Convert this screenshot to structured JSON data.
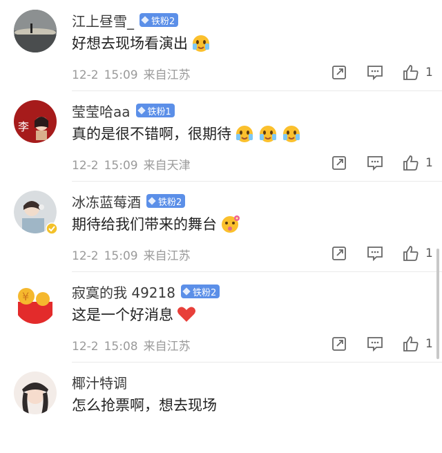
{
  "comments": [
    {
      "name": "江上昼雪_",
      "badge": "铁粉2",
      "text": "好想去现场看演出",
      "emojis": [
        "blush-face"
      ],
      "date": "12-2",
      "time": "15:09",
      "location": "来自江苏",
      "likes": "1",
      "avatar": "landscape-lake-avatar"
    },
    {
      "name": "莹莹哈aa",
      "badge": "铁粉1",
      "text": "真的是很不错啊，很期待",
      "emojis": [
        "blush-face",
        "blush-face",
        "blush-face"
      ],
      "date": "12-2",
      "time": "15:09",
      "location": "来自天津",
      "likes": "1",
      "avatar": "red-li-avatar",
      "avatar_char": "李"
    },
    {
      "name": "冰冻蓝莓酒",
      "badge": "铁粉2",
      "text": "期待给我们带来的舞台",
      "emojis": [
        "flower-face"
      ],
      "date": "12-2",
      "time": "15:09",
      "location": "来自江苏",
      "likes": "1",
      "avatar": "girl-headphones-avatar",
      "verified": true
    },
    {
      "name": "寂寞的我 49218",
      "badge": "铁粉2",
      "text": "这是一个好消息",
      "emojis": [
        "heart"
      ],
      "date": "12-2",
      "time": "15:08",
      "location": "来自江苏",
      "likes": "1",
      "avatar": "red-envelope-avatar"
    },
    {
      "name": "椰汁特调",
      "badge": "",
      "text": "怎么抢票啊，想去现场",
      "emojis": [],
      "date": "",
      "time": "",
      "location": "",
      "likes": "",
      "avatar": "girl-hat-avatar"
    }
  ],
  "colors": {
    "badge": "#5b8fe8",
    "meta": "#9a9a9a",
    "divider": "#e9e9e9",
    "heart": "#e8403a",
    "verified": "#f3c12a"
  }
}
